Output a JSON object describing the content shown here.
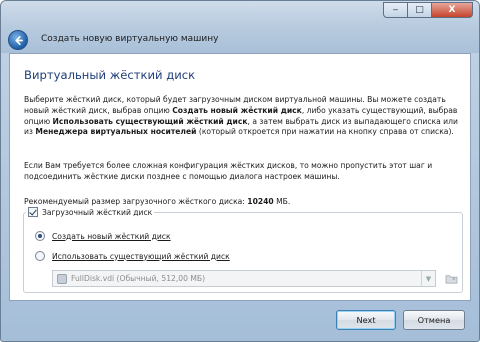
{
  "window": {
    "title": "Создать новую виртуальную машину",
    "controls": {
      "minimize": "‒",
      "maximize": "□",
      "close": "X"
    }
  },
  "page": {
    "heading": "Виртуальный жёсткий диск",
    "intro": {
      "t1": "Выберите жёсткий диск, который будет загрузочным диском виртуальной машины. Вы можете создать новый жёсткий диск, выбрав опцию ",
      "b1": "Создать новый жёсткий диск",
      "t2": ", либо указать существующий, выбрав опцию ",
      "b2": "Использовать существующий жёсткий диск",
      "t3": ", а затем выбрать диск из выпадающего списка или из ",
      "b3": "Менеджера виртуальных носителей",
      "t4": " (который откроется при нажатии на кнопку справа от списка)."
    },
    "advanced": "Если Вам требуется более сложная конфигурация жёстких дисков, то можно пропустить этот шаг и подсоединить жёсткие диски позднее с помощью диалога настроек машины.",
    "recommended": {
      "label": "Рекомендуемый размер загрузочного жёсткого диска: ",
      "value": "10240",
      "unit": " МБ."
    },
    "boot_disk": {
      "label": "Загрузочный жёсткий диск",
      "checked": true,
      "options": [
        {
          "label": "Создать новый жёсткий диск",
          "selected": true
        },
        {
          "label": "Использовать существующий жёсткий диск",
          "selected": false
        }
      ],
      "existing_disk": "FullDisk.vdi (Обычный, 512,00 МБ)"
    }
  },
  "buttons": {
    "next": "Next",
    "cancel": "Отмена"
  }
}
